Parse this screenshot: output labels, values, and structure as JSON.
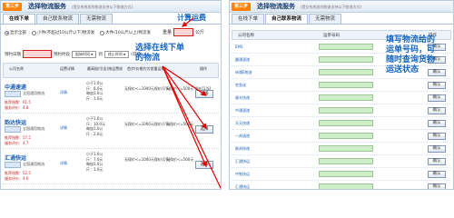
{
  "left": {
    "step": "第三步",
    "title": "选择物流服务",
    "note": "(提交系统发的物流支持以下物流方式)",
    "tabs": [
      "在线下单",
      "自己联系物流",
      "无需物流"
    ],
    "radios": [
      "显示全部",
      "小件(不超过10公斤以下)物流发",
      "大件(10公斤以上)物流发"
    ],
    "weight_label": "重量",
    "weight_unit": "公斤",
    "calc_label": "计算运费",
    "date_label": "预约日期",
    "time_label": "预约时段",
    "time_start": "起始时间",
    "time_to": "到",
    "time_end": "终止时间",
    "time_suffix": "(可选)",
    "callout": "选择在线下单的物流",
    "headers": [
      "公司名称",
      "运费详情",
      "最高赔付(含)按运费收",
      "首步(价格约为首重运输)",
      "操作"
    ],
    "rows": [
      {
        "name": "中通速递",
        "rating": "全国通用物流",
        "score": "推荐指数：61.5",
        "deal": "服务评价：4.8",
        "detail": "详情",
        "price": "小于1.0公\n斤：8.0元\n每加1.0公\n斤：1.0元",
        "ins": "无保价<=1000元保价(1%)",
        "ins2": "无保价<=500元 保价[1%]",
        "pick": "选择"
      },
      {
        "name": "韵达快运",
        "rating": "全国通用物流",
        "score": "推荐指数：57.5",
        "deal": "服务评价：4.7",
        "detail": "详情",
        "price": "小于1.0公\n斤：10.0元\n每加1.0公\n斤：2.0元",
        "ins": "无保价<=1000元保价(1%)",
        "ins2": "无保价<=500元",
        "pick": "选择"
      },
      {
        "name": "汇通快运",
        "rating": "全国通用物流",
        "score": "推荐指数：52.5",
        "deal": "服务评价：4.6",
        "detail": "详情",
        "price": "小于1.0公\n斤：7.0元\n每加1.0公\n斤：1.0元",
        "ins": "无保价<=1000元保价(1%)",
        "ins2": "无保价<=500元",
        "pick": "选择"
      }
    ]
  },
  "right": {
    "step": "第三步",
    "title": "选择物流服务",
    "note": "(提交系统发的物流支持以下物流方式)",
    "tabs": [
      "在线下单",
      "自己联系物流",
      "无需物流"
    ],
    "headers": [
      "公司名称",
      "运单号码",
      "操作"
    ],
    "callout": "填写物流给的运单号码，可随时查询货物运送状态",
    "query_label": "确认",
    "companies": [
      "EMS",
      "圆通速递",
      "申通E物流",
      "宅急送",
      "顺丰快递",
      "中通速递",
      "天天快递",
      "一邦速递",
      "联邦快递",
      "汇通快运",
      "中铁快运",
      "汇通快运"
    ]
  }
}
